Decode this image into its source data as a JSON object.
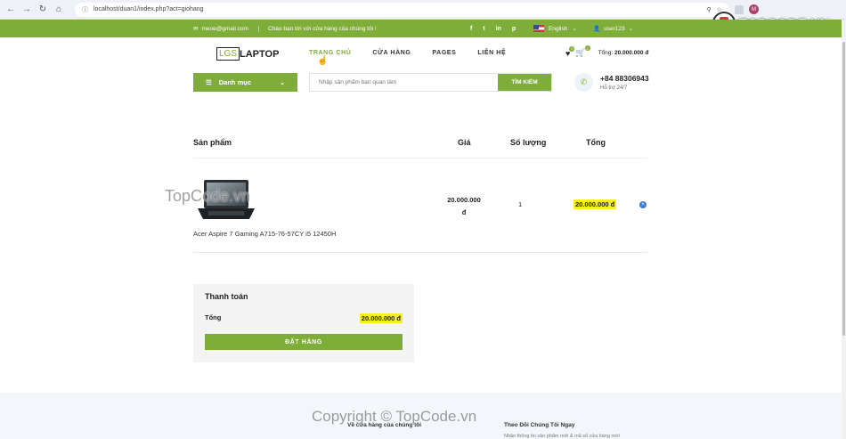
{
  "browser": {
    "url": "localhost/duan1/index.php?act=giohang"
  },
  "brand_overlay": {
    "text": "TOPCODE.VN"
  },
  "topbar": {
    "email": "meoe@gmail.com",
    "welcome": "Chào bạn tới với cửa hàng của chúng tôi !",
    "social": [
      "f",
      "t",
      "in",
      "p"
    ],
    "language": "English",
    "user": "user123"
  },
  "header": {
    "logo_box": "LGS",
    "logo_text": "LAPTOP",
    "menu": [
      "TRANG CHỦ",
      "CỬA HÀNG",
      "PAGES",
      "LIÊN HỆ"
    ],
    "wishlist_count": "0",
    "cart_count": "0",
    "total_label": "Tổng:",
    "total_value": "20.000.000 đ"
  },
  "categories": {
    "label": "Danh mục"
  },
  "search": {
    "placeholder": "Nhập sản phẩm bạn quan tâm",
    "button": "TÌM KIẾM"
  },
  "contact": {
    "phone": "+84 88306943",
    "support": "Hỗ trợ 24/7"
  },
  "cart": {
    "columns": {
      "product": "Sản phẩm",
      "price": "Giá",
      "qty": "Số lượng",
      "total": "Tổng"
    },
    "items": [
      {
        "name": "Acer Aspire 7 Gaming A715-76-57CY i5 12450H",
        "price_line1": "20.000.000",
        "price_line2": "đ",
        "qty": "1",
        "total": "20.000.000 đ"
      }
    ]
  },
  "checkout": {
    "title": "Thanh toán",
    "sum_label": "Tổng",
    "sum_value": "20.000.000 đ",
    "button": "ĐẶT HÀNG"
  },
  "footer": {
    "col1_title": "Về cửa hàng của chúng tôi",
    "col2_title": "Theo Dõi Chúng Tôi Ngay",
    "col2_sub": "Nhận thông tin sản phẩm mới & mã số cửa hàng mới"
  },
  "watermark": {
    "middle": "TopCode.vn",
    "bottom": "Copyright © TopCode.vn"
  },
  "colors": {
    "accent": "#7fad39",
    "highlight": "#f7f020"
  }
}
